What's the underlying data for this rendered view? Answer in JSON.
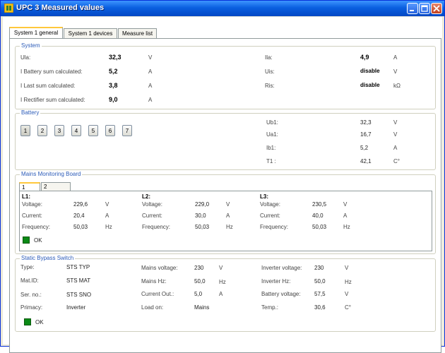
{
  "window": {
    "title": "UPC 3 Measured values",
    "icon": "app-icon",
    "controls": [
      "minimize-icon",
      "maximize-icon",
      "close-icon"
    ]
  },
  "tabs": [
    "System 1 general",
    "System 1 devices",
    "Measure list"
  ],
  "system": {
    "title": "System",
    "left": [
      {
        "label": "Ula:",
        "value": "32,3",
        "unit": "V"
      },
      {
        "label": "I Battery sum calculated:",
        "value": "5,2",
        "unit": "A"
      },
      {
        "label": "I Last sum calculated:",
        "value": "3,8",
        "unit": "A"
      },
      {
        "label": "I Rectifier sum calculated:",
        "value": "9,0",
        "unit": "A"
      }
    ],
    "right": [
      {
        "label": "Ila:",
        "value": "4,9",
        "unit": "A"
      },
      {
        "label": "Uis:",
        "value": "disable",
        "unit": "V"
      },
      {
        "label": "Ris:",
        "value": "disable",
        "unit": "kΩ"
      }
    ]
  },
  "battery": {
    "title": "Battery",
    "buttons": [
      "1",
      "2",
      "3",
      "4",
      "5",
      "6",
      "7"
    ],
    "selected": "1",
    "values": [
      {
        "label": "Ub1:",
        "value": "32,3",
        "unit": "V"
      },
      {
        "label": "Ua1:",
        "value": "16,7",
        "unit": "V"
      },
      {
        "label": "Ib1:",
        "value": "5,2",
        "unit": "A"
      },
      {
        "label": "T1 :",
        "value": "42,1",
        "unit": "C°"
      }
    ]
  },
  "mains": {
    "title": "Mains Monitoring Board",
    "subtabs": [
      "1",
      "2"
    ],
    "phases": [
      {
        "name": "L1:",
        "rows": [
          {
            "label": "Voltage:",
            "value": "229,6",
            "unit": "V"
          },
          {
            "label": "Current:",
            "value": "20,4",
            "unit": "A"
          },
          {
            "label": "Frequency:",
            "value": "50,03",
            "unit": "Hz"
          }
        ]
      },
      {
        "name": "L2:",
        "rows": [
          {
            "label": "Voltage:",
            "value": "229,0",
            "unit": "V"
          },
          {
            "label": "Current:",
            "value": "30,0",
            "unit": "A"
          },
          {
            "label": "Frequency:",
            "value": "50,03",
            "unit": "Hz"
          }
        ]
      },
      {
        "name": "L3:",
        "rows": [
          {
            "label": "Voltage:",
            "value": "230,5",
            "unit": "V"
          },
          {
            "label": "Current:",
            "value": "40,0",
            "unit": "A"
          },
          {
            "label": "Frequency:",
            "value": "50,03",
            "unit": "Hz"
          }
        ]
      }
    ],
    "status": "OK",
    "status_color": "#0b8a16"
  },
  "bypass": {
    "title": "Static Bypass Switch",
    "col1": [
      {
        "label": "Type:",
        "value": "STS TYP"
      },
      {
        "label": "Mat.ID:",
        "value": "STS MAT"
      },
      {
        "label": "Ser. no.:",
        "value": "STS SNO"
      },
      {
        "label": "Primacy:",
        "value": "Inverter"
      }
    ],
    "col2": [
      {
        "label": "Mains voltage:",
        "value": "230",
        "unit": "V"
      },
      {
        "label": "Mains Hz:",
        "value": "50,0",
        "unit": "Hz"
      },
      {
        "label": "Current Out.:",
        "value": "5,0",
        "unit": "A"
      },
      {
        "label": "Load on:",
        "value": "Mains",
        "unit": ""
      }
    ],
    "col3": [
      {
        "label": "Inverter voltage:",
        "value": "230",
        "unit": "V"
      },
      {
        "label": "Inverter Hz:",
        "value": "50,0",
        "unit": "Hz"
      },
      {
        "label": "Battery voltage:",
        "value": "57,5",
        "unit": "V"
      },
      {
        "label": "Temp.:",
        "value": "30,6",
        "unit": "C°"
      }
    ],
    "status": "OK",
    "status_color": "#0b8a16"
  }
}
